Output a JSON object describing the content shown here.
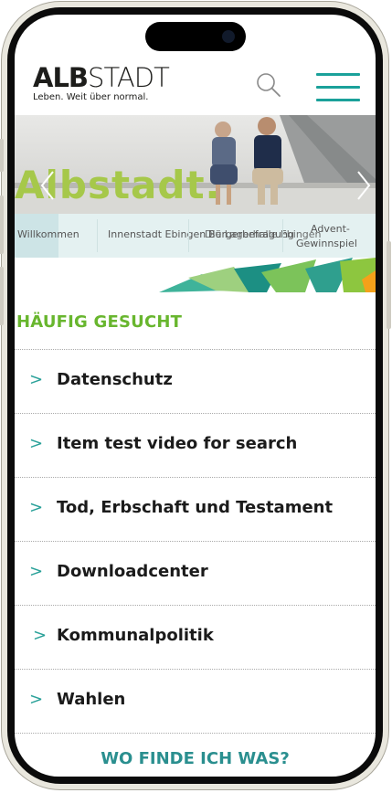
{
  "header": {
    "logo_word_bold": "ALB",
    "logo_word_light": "STADT",
    "logo_tagline": "Leben. Weit über normal."
  },
  "hero": {
    "title": "Albstadt."
  },
  "tabs": [
    {
      "label": "Willkommen"
    },
    {
      "label": "Innenstadt Ebingen"
    },
    {
      "label": "Bürgerbefragung"
    },
    {
      "label": "Die Lagerhalle Ebingen"
    },
    {
      "label": "Advent-"
    },
    {
      "label": "Gewinnspiel"
    }
  ],
  "section": {
    "title": "HÄUFIG GESUCHT",
    "chevron": ">",
    "items": [
      {
        "label": "Datenschutz"
      },
      {
        "label": "Item test video for search"
      },
      {
        "label": "Tod, Erbschaft und Testament"
      },
      {
        "label": "Downloadcenter"
      },
      {
        "label": "Kommunalpolitik"
      },
      {
        "label": "Wahlen"
      }
    ]
  },
  "where": {
    "title": "WO FINDE ICH WAS?"
  },
  "colors": {
    "accent_teal": "#1aa19a",
    "section_green": "#68b62e",
    "hero_green": "#a6c84a",
    "tab_bg": "#e4f1f1"
  },
  "icons": {
    "search": "magnifier-icon",
    "menu": "hamburger-icon",
    "next": "chevron-right-icon",
    "prev": "chevron-left-icon"
  }
}
